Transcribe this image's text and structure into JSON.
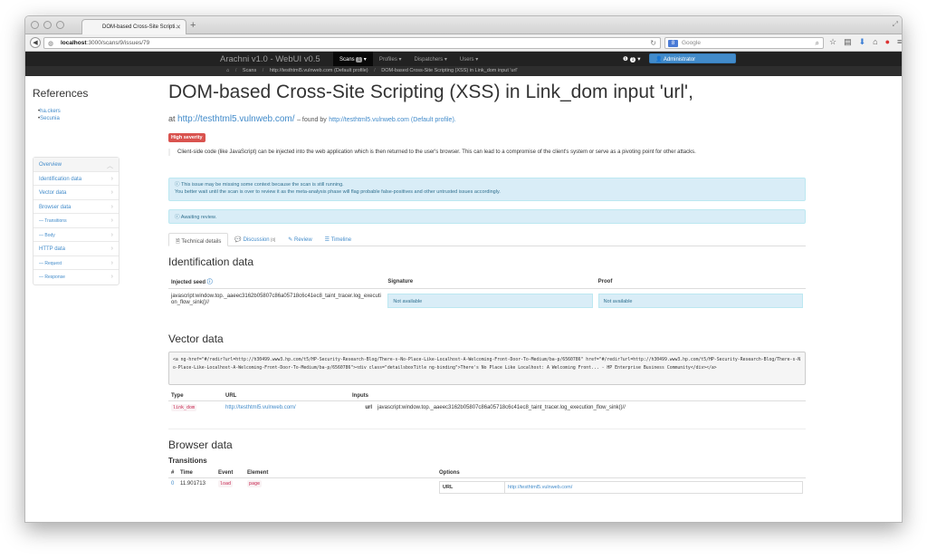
{
  "browser": {
    "tab_title": "DOM-based Cross-Site Scripti...",
    "url_host": "localhost",
    "url_path": ":3000/scans/9/issues/79",
    "search_placeholder": "Google"
  },
  "appbar": {
    "brand": "Arachni v1.0 - WebUI v0.5",
    "nav": [
      {
        "label": "Scans",
        "badge": "1"
      },
      {
        "label": "Profiles ▾"
      },
      {
        "label": "Dispatchers ▾"
      },
      {
        "label": "Users ▾"
      }
    ],
    "notifications_count": "1",
    "user_label": "Administrator"
  },
  "breadcrumb": {
    "items": [
      "Scans",
      "http://testhtml5.vulnweb.com (Default profile)",
      "DOM-based Cross-Site Scripting (XSS) in Link_dom input 'url'"
    ]
  },
  "sidebar": {
    "references_title": "References",
    "references": [
      "ha.ckers",
      "Secunia"
    ],
    "nav": [
      {
        "label": "Overview",
        "sub": false
      },
      {
        "label": "Identification data",
        "sub": false
      },
      {
        "label": "Vector data",
        "sub": false
      },
      {
        "label": "Browser data",
        "sub": false
      },
      {
        "label": "— Transitions",
        "sub": true
      },
      {
        "label": "— Body",
        "sub": true
      },
      {
        "label": "HTTP data",
        "sub": false
      },
      {
        "label": "— Request",
        "sub": true
      },
      {
        "label": "— Response",
        "sub": true
      }
    ]
  },
  "issue": {
    "title": "DOM-based Cross-Site Scripting (XSS) in Link_dom input 'url',",
    "at_label": "at",
    "url": "http://testhtml5.vulnweb.com/",
    "found_by_label": "– found by",
    "profile_link": "http://testhtml5.vulnweb.com (Default profile).",
    "severity": "High severity",
    "description": "Client-side code (like JavaScript) can be injected into the web application which is then returned to the user's browser. This can lead to a compromise of the client's system or serve as a pivoting point for other attacks.",
    "alert_running_line1": "This issue may be missing some context because the scan is still running.",
    "alert_running_line2": "You better wait until the scan is over to review it as the meta-analysis phase will flag probable false-positives and other untrusted issues accordingly.",
    "alert_review": "Awaiting review."
  },
  "tabs": [
    {
      "label": "Technical details"
    },
    {
      "label": "Discussion",
      "count": "[0]"
    },
    {
      "label": "Review"
    },
    {
      "label": "Timeline"
    }
  ],
  "identification": {
    "heading": "Identification data",
    "columns": [
      "Injected seed",
      "Signature",
      "Proof"
    ],
    "seed": "javascript:window.top._aaeec3162b05807c86a05718c6c41ec8_taint_tracer.log_execution_flow_sink()//",
    "signature": "Not available",
    "proof": "Not available"
  },
  "vector": {
    "heading": "Vector data",
    "code": "<a ng-href=\"#/redir?url=http://h30499.www3.hp.com/t5/HP-Security-Research-Blog/There-s-No-Place-Like-Localhost-A-Welcoming-Front-Door-To-Medium/ba-p/6560786\" href=\"#/redir?url=http://h30499.www3.hp.com/t5/HP-Security-Research-Blog/There-s-No-Place-Like-Localhost-A-Welcoming-Front-Door-To-Medium/ba-p/6560786\"><div class=\"detailsboxTitle ng-binding\">There's No Place Like Localhost: A Welcoming Front... - HP Enterprise Business Community</div></a>",
    "columns": [
      "Type",
      "URL",
      "Inputs"
    ],
    "type": "link_dom",
    "url": "http://testhtml5.vulnweb.com/",
    "input_name": "url",
    "input_value": "javascript:window.top._aaeec3162b05807c86a05718c6c41ec8_taint_tracer.log_execution_flow_sink()//"
  },
  "browser_data": {
    "heading": "Browser data",
    "transitions_heading": "Transitions",
    "columns": [
      "#",
      "Time",
      "Event",
      "Element",
      "Options"
    ],
    "row": {
      "index": "0",
      "time": "11.901713",
      "event": "load",
      "element": "page",
      "opt_key": "URL",
      "opt_value": "http://testhtml5.vulnweb.com/"
    }
  }
}
